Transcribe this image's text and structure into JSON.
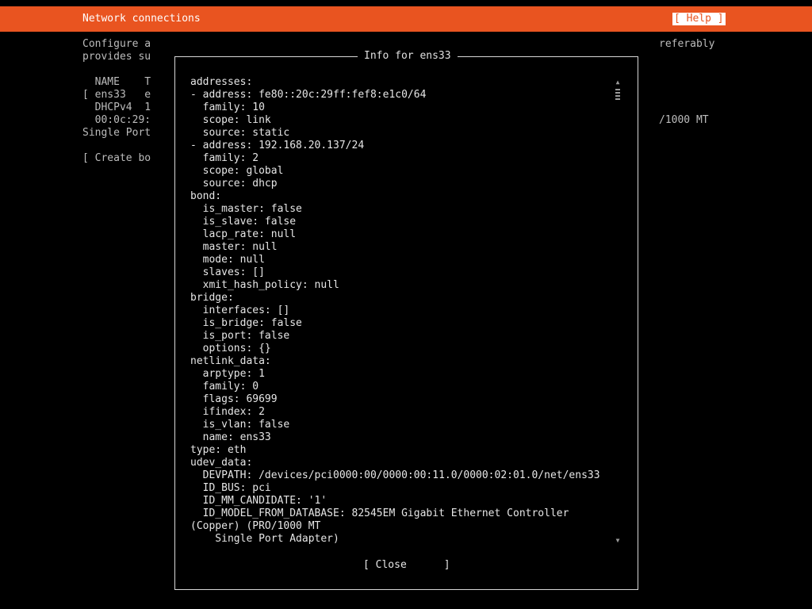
{
  "header": {
    "title": "Network connections",
    "help_label": "[ Help ]"
  },
  "background": {
    "lines_left": [
      "Configure a",
      "provides su",
      "",
      "  NAME    T",
      "[ ens33   e",
      "  DHCPv4  1",
      "  00:0c:29:",
      "Single Port",
      "",
      "[ Create bo"
    ],
    "lines_right": [
      "referably",
      "",
      "",
      "",
      "",
      "",
      "/1000 MT"
    ]
  },
  "dialog": {
    "title": "Info for ens33",
    "lines": [
      "addresses:",
      "- address: fe80::20c:29ff:fef8:e1c0/64",
      "  family: 10",
      "  scope: link",
      "  source: static",
      "- address: 192.168.20.137/24",
      "  family: 2",
      "  scope: global",
      "  source: dhcp",
      "bond:",
      "  is_master: false",
      "  is_slave: false",
      "  lacp_rate: null",
      "  master: null",
      "  mode: null",
      "  slaves: []",
      "  xmit_hash_policy: null",
      "bridge:",
      "  interfaces: []",
      "  is_bridge: false",
      "  is_port: false",
      "  options: {}",
      "netlink_data:",
      "  arptype: 1",
      "  family: 0",
      "  flags: 69699",
      "  ifindex: 2",
      "  is_vlan: false",
      "  name: ens33",
      "type: eth",
      "udev_data:",
      "  DEVPATH: /devices/pci0000:00/0000:00:11.0/0000:02:01.0/net/ens33",
      "  ID_BUS: pci",
      "  ID_MM_CANDIDATE: '1'",
      "  ID_MODEL_FROM_DATABASE: 82545EM Gigabit Ethernet Controller",
      "(Copper) (PRO/1000 MT",
      "    Single Port Adapter)"
    ],
    "scroll_up_icon": "▲",
    "scroll_down_icon": "▼",
    "close_label": "[ Close      ]"
  },
  "colors": {
    "accent": "#e95420",
    "background": "#000000",
    "text": "#d8d8d8"
  }
}
